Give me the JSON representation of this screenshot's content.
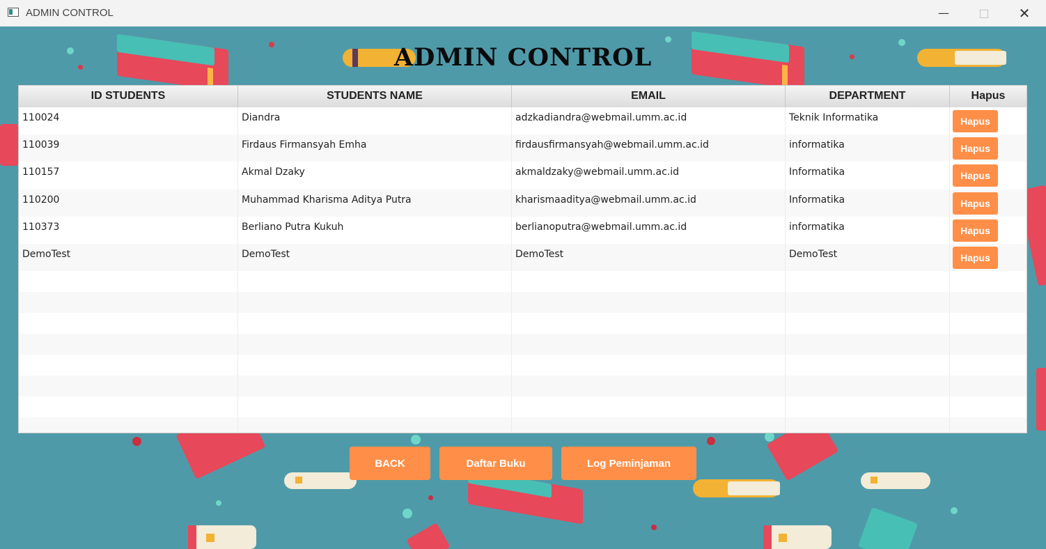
{
  "window": {
    "title": "ADMIN CONTROL"
  },
  "page": {
    "heading": "ADMIN CONTROL"
  },
  "table": {
    "columns": [
      "ID STUDENTS",
      "STUDENTS NAME",
      "EMAIL",
      "DEPARTMENT",
      "Hapus"
    ],
    "rows": [
      {
        "id": "110024",
        "name": "Diandra",
        "email": "adzkadiandra@webmail.umm.ac.id",
        "department": "Teknik Informatika",
        "action": "Hapus"
      },
      {
        "id": "110039",
        "name": "Firdaus Firmansyah Emha",
        "email": "firdausfirmansyah@webmail.umm.ac.id",
        "department": "informatika",
        "action": "Hapus"
      },
      {
        "id": "110157",
        "name": "Akmal Dzaky",
        "email": "akmaldzaky@webmail.umm.ac.id",
        "department": "Informatika",
        "action": "Hapus"
      },
      {
        "id": "110200",
        "name": "Muhammad Kharisma Aditya Putra",
        "email": "kharismaaditya@webmail.umm.ac.id",
        "department": "Informatika",
        "action": "Hapus"
      },
      {
        "id": "110373",
        "name": "Berliano Putra Kukuh",
        "email": "berlianoputra@webmail.umm.ac.id",
        "department": "informatika",
        "action": "Hapus"
      },
      {
        "id": "DemoTest",
        "name": "DemoTest",
        "email": "DemoTest",
        "department": "DemoTest",
        "action": "Hapus"
      }
    ]
  },
  "buttons": {
    "back": "BACK",
    "daftar_buku": "Daftar Buku",
    "log_peminjaman": "Log Peminjaman"
  },
  "colors": {
    "accent": "#ff8f48",
    "background": "#4f9aa9"
  },
  "icons": {
    "minimize": "minimize-icon",
    "maximize": "maximize-icon",
    "close": "close-icon"
  }
}
